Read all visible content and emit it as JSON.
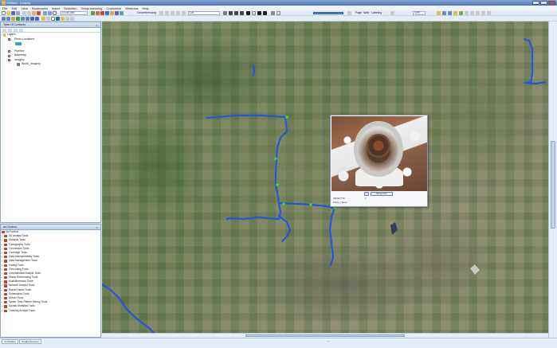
{
  "window": {
    "title": "Untitled - ArcMap"
  },
  "menu": {
    "items": [
      "File",
      "Edit",
      "View",
      "Bookmarks",
      "Insert",
      "Selection",
      "Geoprocessing",
      "Customize",
      "Windows",
      "Help"
    ]
  },
  "toolbar": {
    "scale_value": "1:144,384",
    "georef_label": "Georeferencing",
    "layer_value": "Lot",
    "page_label": "Page Table",
    "labeling_label": "Labeling",
    "size_value": "10%"
  },
  "toc": {
    "title": "Table Of Contents",
    "root": "Layers",
    "layers": [
      {
        "name": "Photo Locations",
        "checked": true
      },
      {
        "name": "Pipeline",
        "checked": true
      },
      {
        "name": "Basemap",
        "checked": false
      },
      {
        "name": "Imagery",
        "checked": true
      },
      {
        "name": "World_Imagery",
        "checked": false
      }
    ]
  },
  "arctoolbox": {
    "title": "ArcToolbox",
    "root": "ArcToolbox",
    "items": [
      "3D Analyst Tools",
      "Analysis Tools",
      "Cartography Tools",
      "Conversion Tools",
      "Coverage Tools",
      "Data Interoperability Tools",
      "Data Management Tools",
      "Editing Tools",
      "Geocoding Tools",
      "Geostatistical Analyst Tools",
      "Linear Referencing Tools",
      "Multidimension Tools",
      "Network Analyst Tools",
      "Parcel Fabric Tools",
      "Schematics Tools",
      "Server Tools",
      "Space Time Pattern Mining Tools",
      "Spatial Statistics Tools",
      "Tracking Analyst Tools"
    ]
  },
  "popup": {
    "show_info_label": "Show Info",
    "attributes": [
      {
        "key": "OBJECTID",
        "value": "1"
      },
      {
        "key": "Photo_Name",
        "value": "..."
      }
    ]
  },
  "status": {
    "tabs": [
      "ArcToolbox",
      "Create Features"
    ],
    "coords": "---"
  },
  "colors": {
    "pipeline": "#2255e0",
    "pipeline_node": "#3cd84a"
  }
}
